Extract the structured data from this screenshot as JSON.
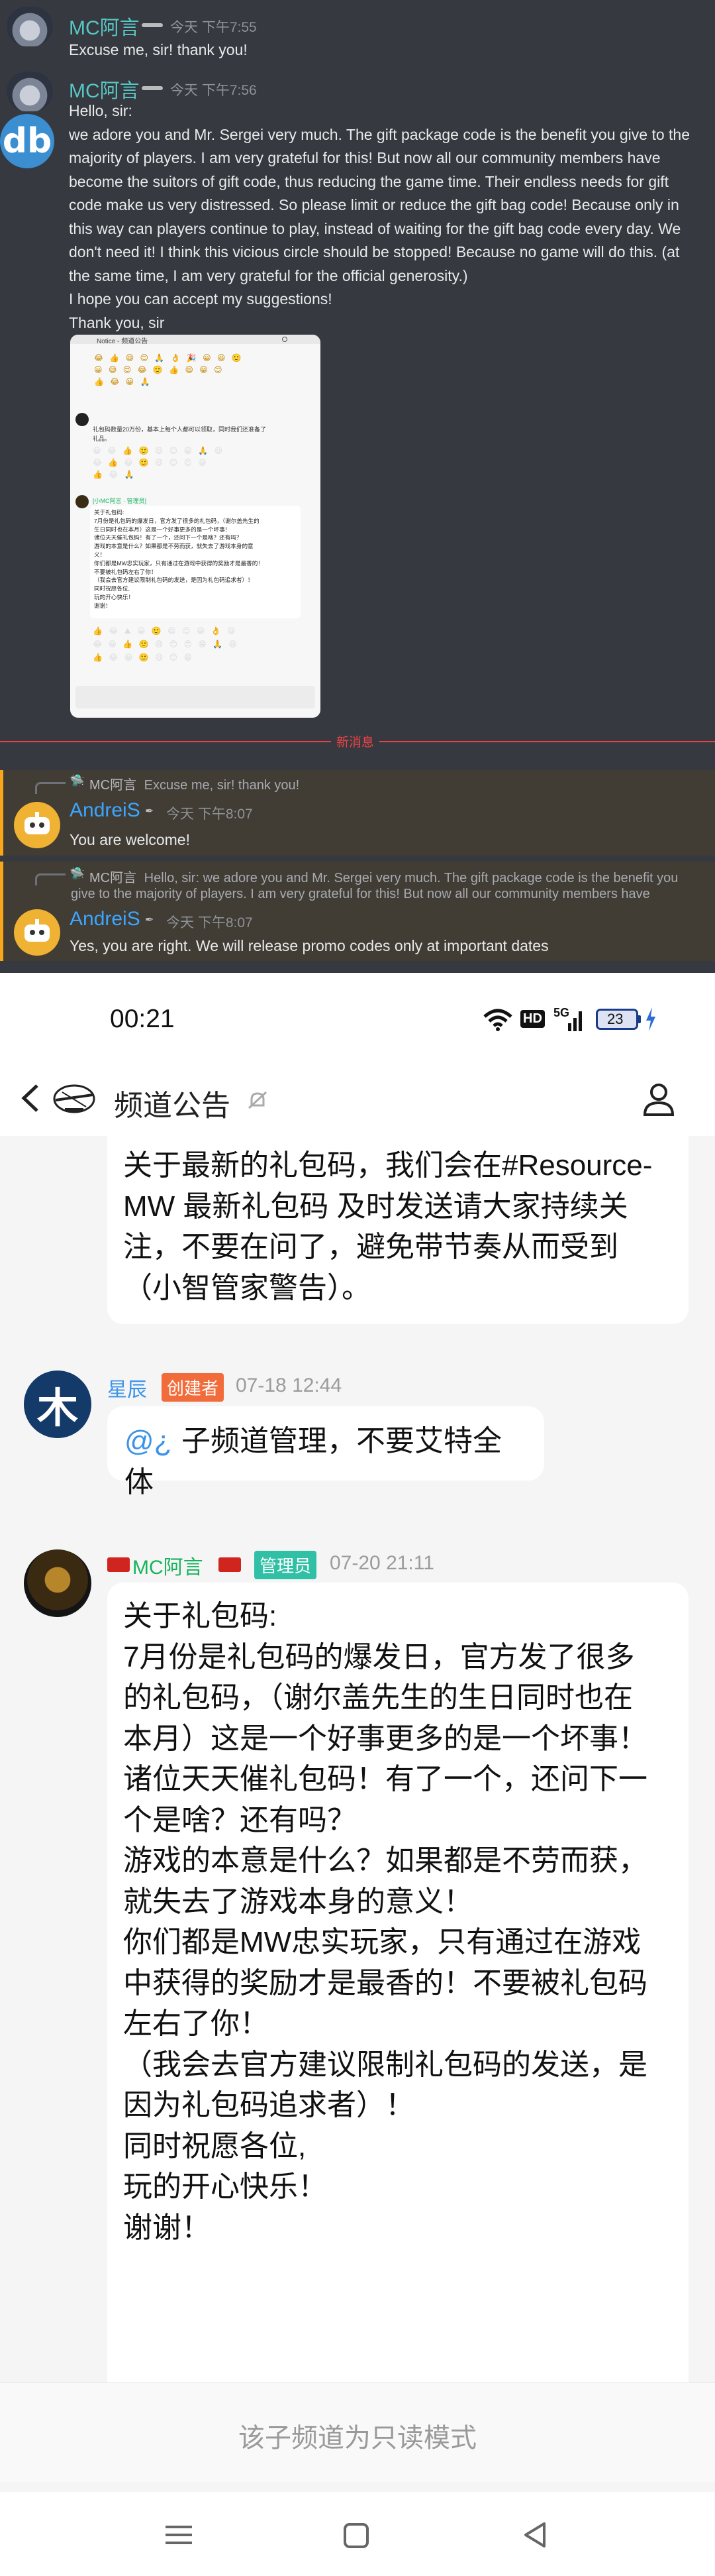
{
  "discord": {
    "msg1": {
      "author": "MC阿言",
      "time": "今天 下午7:55",
      "text": "Excuse me, sir! thank you!"
    },
    "msg2": {
      "author": "MC阿言",
      "time": "今天 下午7:56",
      "avatar_letters": "db",
      "lines": [
        "Hello, sir:",
        "we adore you and Mr. Sergei very much. The gift package code is the benefit you give to the",
        "majority of players. I am very grateful for this! But now all our community members have",
        "become the suitors of gift code, thus reducing the game time. Their endless needs for gift",
        "code make us very distressed. So please limit or reduce the gift bag code! Because only in",
        "this way can players continue to play, instead of waiting for the gift bag code every day. We",
        "don't need it! I think this vicious circle should be stopped! Because no game will do this. (at",
        "the same time, I am very grateful for the official generosity.)",
        "I hope you can accept my suggestions!",
        "Thank you, sir"
      ]
    },
    "attachment": {
      "title": "Notice - 频道公告",
      "msg_a": [
        "礼包码数量20万份，基本上每个人都可以领取，同时我们还准备了",
        "礼品。"
      ],
      "msg_b_author": "[小MC阿言 · 管理员]",
      "msg_b_lines": [
        "关于礼包码:",
        "7月份是礼包码的爆发日，官方发了很多的礼包码，（谢尔盖先生的",
        "生日同时也在本月）这是一个好事更多的是一个坏事！",
        "诸位天天催礼包码！有了一个，还问下一个是啥？还有吗？",
        "游戏的本意是什么？如果都是不劳而获，就失去了游戏本身的意",
        "义！",
        "你们都是MW忠实玩家，只有通过在游戏中获得的奖励才是最香的！",
        "不要被礼包码左右了你！",
        "（我会去官方建议限制礼包码的发送，是因为礼包码追求者）！",
        "同时祝愿各位,",
        "玩的开心快乐！",
        "谢谢！"
      ]
    },
    "new_messages_label": "新消息",
    "reply1": {
      "ref_author": "MC阿言",
      "ref_text": "Excuse me, sir! thank you!",
      "author": "AndreiS",
      "time": "今天 下午8:07",
      "text": "You are welcome!"
    },
    "reply2": {
      "ref_author": "MC阿言",
      "ref_text_line1": "Hello, sir:  we adore you and Mr. Sergei very much. The gift package code is the benefit you",
      "ref_text_line2": "give to the majority of players. I am very grateful for this! But now all our community members have",
      "author": "AndreiS",
      "time": "今天 下午8:07",
      "text": "Yes, you are right. We will release promo codes only at important dates"
    }
  },
  "phone": {
    "status_bar": {
      "time": "00:21",
      "network_hd": "HD",
      "network_5g": "5G",
      "battery": "23"
    },
    "header": {
      "title": "频道公告"
    },
    "msg0": {
      "lines": [
        "关于最新的礼包码，我们会在#Resource-",
        "MW 最新礼包码 及时发送请大家持续关",
        "注，不要在问了，避免带节奏从而受到",
        "（小智管家警告）。"
      ]
    },
    "msg1": {
      "author": "星辰",
      "avatar_char": "木",
      "role": "创建者",
      "time": "07-18 12:44",
      "mention": "@¿",
      "text": "子频道管理，不要艾特全体"
    },
    "msg2": {
      "author": "MC阿言",
      "role": "管理员",
      "time": "07-20 21:11",
      "lines": [
        "关于礼包码:",
        "7月份是礼包码的爆发日，官方发了很多",
        "的礼包码，（谢尔盖先生的生日同时也在",
        "本月）这是一个好事更多的是一个坏事！",
        "诸位天天催礼包码！有了一个，还问下一",
        "个是啥？还有吗？",
        "游戏的本意是什么？如果都是不劳而获，",
        "就失去了游戏本身的意义！",
        "你们都是MW忠实玩家，只有通过在游戏",
        "中获得的奖励才是最香的！不要被礼包码",
        "左右了你！",
        "（我会去官方建议限制礼包码的发送，是",
        "因为礼包码追求者）！",
        "同时祝愿各位,",
        "玩的开心快乐！",
        "谢谢！"
      ]
    },
    "read_only_notice": "该子频道为只读模式"
  },
  "colors": {
    "discord_bg": "#36393f",
    "discord_name": "#57c7c5",
    "andrei_name": "#3ba6ff",
    "new_msg_red": "#ed4245",
    "mention_highlight": "#faa61a",
    "creator_badge": "#f26b3a",
    "admin_badge": "#2fc0a5",
    "nick_blue": "#3c93e8",
    "nick_green": "#16b35c"
  }
}
